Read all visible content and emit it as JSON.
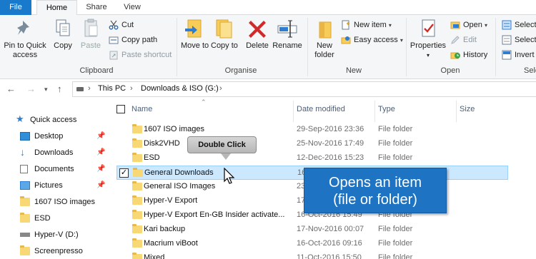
{
  "tabs": {
    "file": "File",
    "home": "Home",
    "share": "Share",
    "view": "View"
  },
  "ribbon": {
    "clipboard": {
      "pin": "Pin to Quick access",
      "copy": "Copy",
      "paste": "Paste",
      "cut": "Cut",
      "copy_path": "Copy path",
      "paste_shortcut": "Paste shortcut",
      "label": "Clipboard"
    },
    "organise": {
      "move_to": "Move to",
      "copy_to": "Copy to",
      "delete": "Delete",
      "rename": "Rename",
      "label": "Organise"
    },
    "new": {
      "new_folder": "New folder",
      "new_item": "New item",
      "easy_access": "Easy access",
      "label": "New"
    },
    "open": {
      "properties": "Properties",
      "open": "Open",
      "edit": "Edit",
      "history": "History",
      "label": "Open"
    },
    "select": {
      "select_all": "Select",
      "select_none": "Select",
      "invert": "Invert",
      "label": "Sele"
    }
  },
  "address": {
    "this_pc": "This PC",
    "drive": "Downloads & ISO (G:)"
  },
  "nav": {
    "quick_access": "Quick access",
    "items": [
      "Desktop",
      "Downloads",
      "Documents",
      "Pictures",
      "1607 ISO images",
      "ESD",
      "Hyper-V (D:)",
      "Screenpresso"
    ]
  },
  "columns": {
    "name": "Name",
    "date": "Date modified",
    "type": "Type",
    "size": "Size"
  },
  "files": [
    {
      "name": "1607 ISO images",
      "date": "29-Sep-2016 23:36",
      "type": "File folder"
    },
    {
      "name": "Disk2VHD",
      "date": "25-Nov-2016 17:49",
      "type": "File folder"
    },
    {
      "name": "ESD",
      "date": "12-Dec-2016 15:23",
      "type": "File folder"
    },
    {
      "name": "General Downloads",
      "date": "16",
      "type": ""
    },
    {
      "name": "General ISO Images",
      "date": "23",
      "type": ""
    },
    {
      "name": "Hyper-V Export",
      "date": "17",
      "type": ""
    },
    {
      "name": "Hyper-V Export En-GB Insider activate...",
      "date": "16-Oct-2016 15:49",
      "type": "File folder"
    },
    {
      "name": "Kari backup",
      "date": "17-Nov-2016 00:07",
      "type": "File folder"
    },
    {
      "name": "Macrium viBoot",
      "date": "16-Oct-2016 09:16",
      "type": "File folder"
    },
    {
      "name": "Mixed",
      "date": "11-Oct-2016 15:50",
      "type": "File folder"
    }
  ],
  "callouts": {
    "tooltip": "Double Click",
    "info_line1": "Opens an item",
    "info_line2": "(file or folder)"
  }
}
